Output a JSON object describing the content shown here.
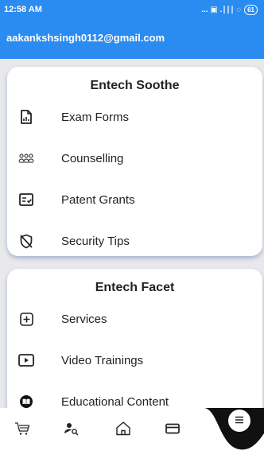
{
  "status_bar": {
    "time": "12:58 AM",
    "indicators": "... ▣ .∣∣∣ ◌",
    "battery": "61"
  },
  "header": {
    "email": "aakankshsingh0112@gmail.com"
  },
  "soothe": {
    "title": "Entech Soothe",
    "items": [
      {
        "label": "Exam Forms",
        "icon": "document-chart-icon"
      },
      {
        "label": "Counselling",
        "icon": "group-icon"
      },
      {
        "label": "Patent Grants",
        "icon": "checklist-icon"
      },
      {
        "label": "Security Tips",
        "icon": "shield-off-icon"
      }
    ]
  },
  "facet": {
    "title": "Entech Facet",
    "items": [
      {
        "label": "Services",
        "icon": "plus-box-icon"
      },
      {
        "label": "Video Trainings",
        "icon": "play-box-icon"
      },
      {
        "label": "Educational Content",
        "icon": "book-circle-icon"
      }
    ]
  },
  "bottom_nav": {
    "items": [
      "cart-icon",
      "person-search-icon",
      "home-icon",
      "card-icon",
      "menu-icon"
    ]
  },
  "colors": {
    "primary": "#2a8cf0",
    "background": "#e9e9ec",
    "card": "#ffffff"
  }
}
